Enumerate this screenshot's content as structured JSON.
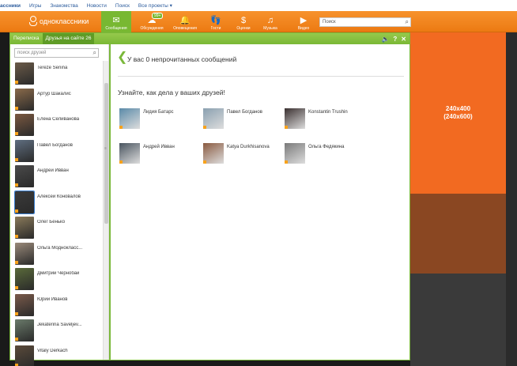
{
  "topnav": [
    "ассники",
    "Игры",
    "Знакомства",
    "Новости",
    "Поиск",
    "Все проекты ▾"
  ],
  "logo": "одноклассники",
  "nav": [
    {
      "label": "Сообщения",
      "icon": "envelope-icon",
      "glyph": "✉",
      "active": true
    },
    {
      "label": "Обсуждения",
      "icon": "discussions-icon",
      "glyph": "☁",
      "badge": "99+"
    },
    {
      "label": "Оповещения",
      "icon": "bell-icon",
      "glyph": "🔔"
    },
    {
      "label": "Гости",
      "icon": "footprints-icon",
      "glyph": "👣"
    },
    {
      "label": "Оценки",
      "icon": "ratings-icon",
      "glyph": "$"
    },
    {
      "label": "Музыка",
      "icon": "music-icon",
      "glyph": "♫"
    },
    {
      "label": "Видео",
      "icon": "video-icon",
      "glyph": "▶"
    }
  ],
  "search": {
    "placeholder": "Поиск"
  },
  "chat": {
    "tabs": [
      "Переписка",
      "Друзья на сайте 26"
    ],
    "controls": [
      "🔈",
      "?",
      "✕"
    ],
    "friend_search_placeholder": "поиск друзей",
    "friends": [
      {
        "name": "Tereze Senina",
        "color": "#6a5a48"
      },
      {
        "name": "Артур Шакалис",
        "color": "#8a6a4a"
      },
      {
        "name": "Елена Селиванова",
        "color": "#7a5840"
      },
      {
        "name": "Павел Богданов",
        "color": "#5f6e80"
      },
      {
        "name": "Андрей Ивван",
        "color": "#4a4a4a"
      },
      {
        "name": "Алексей Коновалов",
        "color": "#3a3a3a",
        "selected": true
      },
      {
        "name": "Олег Бенько",
        "color": "#8a7a5a"
      },
      {
        "name": "Ольга Моднокласс...",
        "color": "#9a8a7a"
      },
      {
        "name": "Дмитрий Чернобай",
        "color": "#5a6a3a"
      },
      {
        "name": "Юрий Иванов",
        "color": "#7a5a4a"
      },
      {
        "name": "Jekaterina Saveljev...",
        "color": "#6a7a6a"
      },
      {
        "name": "Vitaly Derkach",
        "color": "#5a4a3a"
      }
    ],
    "header": "У вас 0 непрочитанных сообщений",
    "subheader": "Узнайте, как дела у ваших друзей!",
    "suggestions": [
      {
        "name": "Лидия Батарс",
        "color": "#5a8aa8"
      },
      {
        "name": "Павел Богданов",
        "color": "#8aa0b0"
      },
      {
        "name": "Konstantin Trushin",
        "color": "#3a3030"
      },
      {
        "name": "Андрей Ивван",
        "color": "#4a5560"
      },
      {
        "name": "Katya Durkhisanova",
        "color": "#8a5a40"
      },
      {
        "name": "Ольга Федякина",
        "color": "#7a7a7a"
      }
    ]
  },
  "ad": {
    "line1": "240x400",
    "line2": "(240x600)"
  }
}
